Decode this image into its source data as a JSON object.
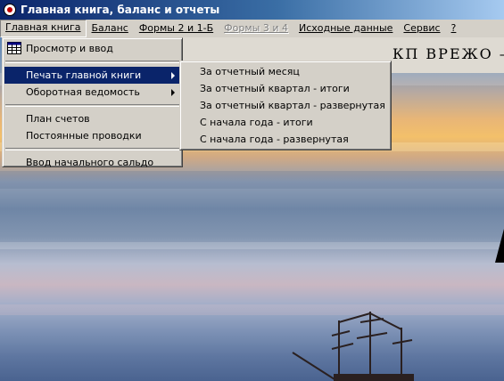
{
  "window": {
    "title": "Главная книга, баланс и отчеты"
  },
  "menubar": {
    "items": [
      {
        "label": "Главная книга",
        "state": "open"
      },
      {
        "label": "Баланс",
        "state": "normal"
      },
      {
        "label": "Формы 2 и 1-Б",
        "state": "normal"
      },
      {
        "label": "Формы 3 и 4",
        "state": "disabled"
      },
      {
        "label": "Исходные данные",
        "state": "normal"
      },
      {
        "label": "Сервис",
        "state": "normal"
      },
      {
        "label": "?",
        "state": "normal"
      }
    ]
  },
  "main_menu": {
    "view_and_input": "Просмотр и ввод",
    "print_ledger": "Печать главной книги",
    "turnover_sheet": "Оборотная ведомость",
    "chart_of_accounts": "План счетов",
    "standing_entries": "Постоянные проводки",
    "opening_balance": "Ввод начального сальдо",
    "highlight_color": "#0a246a"
  },
  "submenu": {
    "items": [
      "За отчетный месяц",
      "За отчетный квартал - итоги",
      "За отчетный квартал - развернутая",
      "С начала года - итоги",
      "С начала года - развернутая"
    ]
  },
  "background": {
    "header_text": "КП ВРЕЖО –"
  },
  "icons": {
    "app": "app-icon",
    "view": "ledger-grid-icon",
    "submenu_arrow": "submenu-arrow-icon"
  }
}
